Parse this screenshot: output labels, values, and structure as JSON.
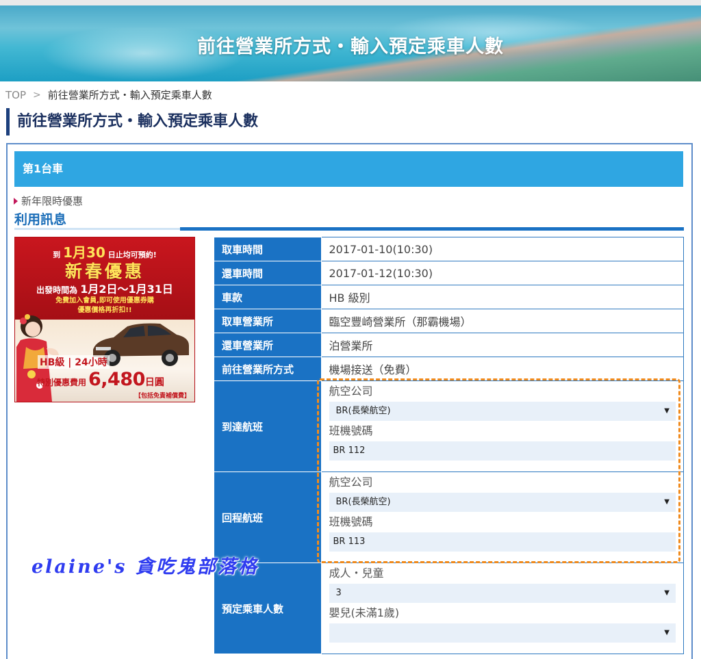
{
  "banner": {
    "title": "前往營業所方式・輸入預定乘車人數"
  },
  "breadcrumb": {
    "home": "TOP",
    "separator": ">",
    "current": "前往營業所方式・輸入預定乘車人數"
  },
  "page_title": "前往營業所方式・輸入預定乘車人數",
  "car_section": {
    "header": "第1台車",
    "promo_label": "新年限時優惠",
    "usage_title": "利用訊息"
  },
  "promo_banner": {
    "line1_pre": "到",
    "line1_date": "1月30",
    "line1_post": "日止均可預約!",
    "headline": "新春優惠",
    "line3_pre": "出發時間為",
    "line3_dates": "1月2日～1月31日",
    "line4a": "免費加入會員,即可使用優惠券購",
    "line4b": "優惠價格再折扣!!",
    "hb_text": "HB級 | 24小時",
    "price_label": "特別優惠費用",
    "price_value": "6,480",
    "price_unit": "日圓",
    "footnote": "【包括免責補償費】"
  },
  "info": {
    "pickup_time_label": "取車時間",
    "pickup_time": "2017-01-10(10:30)",
    "return_time_label": "還車時間",
    "return_time": "2017-01-12(10:30)",
    "car_model_label": "車款",
    "car_model": "HB 級別",
    "pickup_office_label": "取車營業所",
    "pickup_office": "臨空豐崎營業所（那霸機場）",
    "return_office_label": "還車營業所",
    "return_office": "泊營業所",
    "access_label": "前往營業所方式",
    "access": "機場接送（免費）"
  },
  "arrival_flight": {
    "label": "到達航班",
    "airline_label": "航空公司",
    "airline_value": "BR(長榮航空)",
    "flight_no_label": "班機號碼",
    "flight_no_value": "BR 112"
  },
  "return_flight": {
    "label": "回程航班",
    "airline_label": "航空公司",
    "airline_value": "BR(長榮航空)",
    "flight_no_label": "班機號碼",
    "flight_no_value": "BR 113"
  },
  "passengers": {
    "label": "預定乘車人數",
    "adult_label": "成人・兒童",
    "adult_value": "3",
    "infant_label": "嬰兒(未滿1歲)",
    "infant_value": ""
  },
  "watermark": "elaine's 貪吃鬼部落格",
  "colors": {
    "accent_blue": "#1a72c4",
    "header_blue": "#2fa6e2",
    "highlight_orange": "#f08a1c"
  }
}
